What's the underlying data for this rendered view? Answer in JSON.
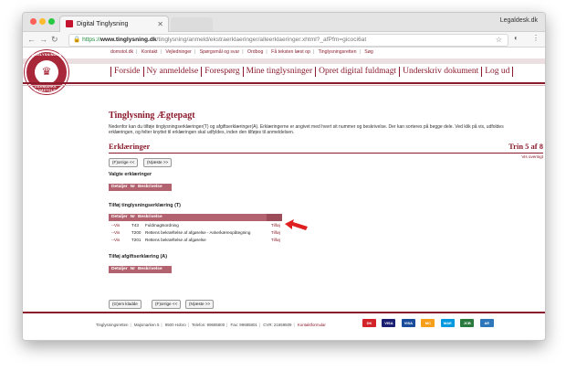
{
  "browser": {
    "tab_title": "Digital Tinglysning",
    "window_title": "Legaldesk.dk",
    "url_scheme": "https://",
    "url_host": "www.tinglysning.dk",
    "url_path": "/tinglysning/anmeld/ekstraerklaeringer/alleerklaeringer.xhtml?_afPfm=gicoci6at"
  },
  "site": {
    "logo_top": "TINGLYSNINGSRETTEN",
    "logo_bottom": "DANMARKS DOMSTOLE",
    "toplinks": [
      "domstol.dk",
      "Kontakt",
      "Vejledninger",
      "Spørgsmål og svar",
      "Ordbog",
      "Få teksten læst op",
      "Tinglysningsretten",
      "Søg"
    ],
    "nav": [
      "Forside",
      "Ny anmeldelse",
      "Forespørg",
      "Mine tinglysninger",
      "Opret digital fuldmagt",
      "Underskriv dokument",
      "Log ud"
    ]
  },
  "page": {
    "title": "Tinglysning Ægtepagt",
    "intro": "Nedenfor kan du tilføje tinglysningserklæringer(T) og afgiftserklæringer(A). Erklæringerne er angivet med hvert sit nummer og beskrivelse. Der kan sorteres på begge dele. Ved klik på vis, udfoldes erklæringen, og felter knyttet til erklæringen skal udfyldes, inden den tilføjes til anmeldelsen.",
    "section": "Erklæringer",
    "step": "Trin 5 af 8",
    "vis_oversigt": "Vis oversigt",
    "btn_prev": "(F)orrige <<",
    "btn_next": "(N)æste >>",
    "btn_save": "(G)em kladde",
    "valgte_label": "Valgte erklæringer",
    "tilfoej_t_label": "Tilføj tinglysningserklæring (T)",
    "tilfoej_a_label": "Tilføj afgiftserklæring (A)",
    "cols": {
      "detaljer": "Detaljer",
      "nr": "Nr",
      "beskrivelse": "Beskrivelse"
    },
    "rows": [
      {
        "vis": "--Vis",
        "nr": "T43",
        "beskrivelse": "Fuldmagtsordning",
        "action": "Tilføj"
      },
      {
        "vis": "--Vis",
        "nr": "T200",
        "beskrivelse": "Rettens bekræftelse af afgørelse - Anke/kæreopåtegning",
        "action": "Tilføj"
      },
      {
        "vis": "--Vis",
        "nr": "T201",
        "beskrivelse": "Rettens bekræftelse af afgørelse",
        "action": "Tilføj"
      }
    ]
  },
  "footer": {
    "items": [
      "Tinglysningsretten",
      "Majsmarken 5",
      "9500 Hobro",
      "Telefon: 99685800",
      "Fax: 99685801",
      "CVR: 21659509"
    ],
    "contact": "Kontaktformular",
    "cards": [
      "DK",
      "VISA",
      "VISA",
      "MC",
      "MAE",
      "JCB",
      "AE"
    ]
  },
  "colors": {
    "accent": "#8a1a2c",
    "table_header": "#b2636f",
    "arrow": "#e02020"
  }
}
